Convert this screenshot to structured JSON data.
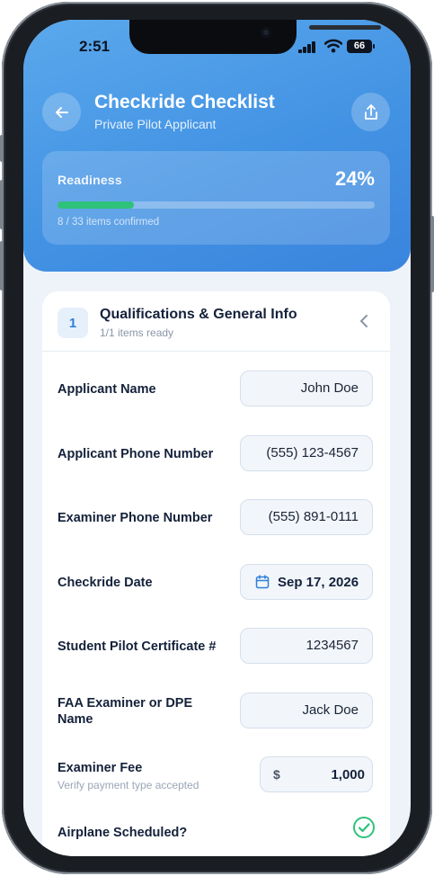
{
  "status_bar": {
    "time": "2:51",
    "battery": "66"
  },
  "header": {
    "title": "Checkride Checklist",
    "subtitle": "Private Pilot Applicant"
  },
  "readiness": {
    "label": "Readiness",
    "percent_text": "24%",
    "progress_fraction": 0.24,
    "count_text": "8 / 33 items confirmed",
    "accent": "#2ec27a"
  },
  "section": {
    "number": "1",
    "title": "Qualifications & General Info",
    "subtitle": "1/1 items ready",
    "rows": [
      {
        "label": "Applicant Name",
        "value": "John Doe"
      },
      {
        "label": "Applicant Phone Number",
        "value": "(555) 123-4567"
      },
      {
        "label": "Examiner Phone Number",
        "value": "(555) 891-0111"
      },
      {
        "label": "Checkride Date",
        "value": "Sep 17, 2026"
      },
      {
        "label": "Student Pilot Certificate #",
        "value": "1234567"
      },
      {
        "label": "FAA Examiner or DPE Name",
        "value": "Jack Doe"
      },
      {
        "label": "Examiner Fee",
        "hint": "Verify payment type accepted",
        "currency": "$",
        "value": "1,000"
      },
      {
        "label": "Airplane Scheduled?",
        "checked": true
      }
    ]
  },
  "icons": {
    "back": "arrow-left-icon",
    "share": "share-icon",
    "collapse": "chevron-left-icon",
    "date": "calendar-icon",
    "check": "check-circle-icon"
  },
  "colors": {
    "header": "#4393e4",
    "check": "#2ec27a"
  }
}
